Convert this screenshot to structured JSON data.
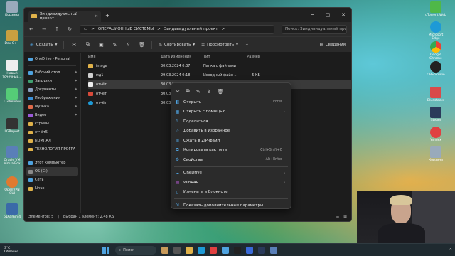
{
  "window": {
    "tab_title": "Зиндивидуальный проект",
    "tab_close": "×",
    "new_tab": "+",
    "controls": {
      "minimize": "─",
      "maximize": "□",
      "close": "✕"
    }
  },
  "nav": {
    "breadcrumb": [
      "ОПЕРАЦИОННЫЕ СИСТЕМЫ",
      "Зиндивидуальный проект"
    ],
    "breadcrumb_sep": ">",
    "search_placeholder": "Поиск: Зиндивидуальный про"
  },
  "toolbar": {
    "create": "Создать",
    "sort": "Сортировать",
    "view": "Просмотреть",
    "more": "···",
    "details": "Сведения"
  },
  "sidebar": {
    "items": [
      {
        "label": "OneDrive - Personal",
        "pinned": false
      },
      {
        "label": "Рабочий стол",
        "pinned": true
      },
      {
        "label": "Загрузки",
        "pinned": true
      },
      {
        "label": "Документы",
        "pinned": true
      },
      {
        "label": "Изображения",
        "pinned": true
      },
      {
        "label": "Музыка",
        "pinned": true
      },
      {
        "label": "Видео",
        "pinned": true
      },
      {
        "label": "стримы",
        "pinned": false
      },
      {
        "label": "отчёт5",
        "pinned": false
      },
      {
        "label": "КОМПАЛ",
        "pinned": false
      },
      {
        "label": "ТЕХНОЛОГИЯ ПРОГРА",
        "pinned": false
      }
    ],
    "bottom": [
      {
        "label": "Этот компьютер"
      },
      {
        "label": "OS (C:)"
      },
      {
        "label": "Сеть"
      },
      {
        "label": "Linux"
      }
    ]
  },
  "files": {
    "headers": {
      "name": "Имя",
      "date": "Дата изменения",
      "type": "Тип",
      "size": "Размер"
    },
    "rows": [
      {
        "name": "image",
        "date": "30.03.2024 0:37",
        "type": "Папка с файлами",
        "size": ""
      },
      {
        "name": "мд1",
        "date": "29.03.2024 0:18",
        "type": "Исходный файл ...",
        "size": "5 КБ"
      },
      {
        "name": "отчёт",
        "date": "30.03.2024 ...",
        "type": "",
        "size": ""
      },
      {
        "name": "отчёт",
        "date": "30.03.2024 ...",
        "type": "",
        "size": ""
      },
      {
        "name": "отчёт",
        "date": "30.03.2024 ...",
        "type": "",
        "size": ""
      }
    ]
  },
  "status": {
    "items_count": "Элементов: 5",
    "selected": "Выбран 1 элемент: 2,48 КБ"
  },
  "context_menu": {
    "items": [
      {
        "label": "Открыть",
        "shortcut": "Enter",
        "submenu": false
      },
      {
        "label": "Открыть с помощью",
        "shortcut": "",
        "submenu": true
      },
      {
        "label": "Поделиться",
        "shortcut": "",
        "submenu": false
      },
      {
        "label": "Добавить в избранное",
        "shortcut": "",
        "submenu": false
      },
      {
        "label": "Сжать в ZIP-файл",
        "shortcut": "",
        "submenu": false
      },
      {
        "label": "Копировать как путь",
        "shortcut": "Ctrl+Shift+C",
        "submenu": false
      },
      {
        "label": "Свойства",
        "shortcut": "Alt+Enter",
        "submenu": false
      },
      {
        "label": "OneDrive",
        "shortcut": "",
        "submenu": true
      },
      {
        "label": "WinRAR",
        "shortcut": "",
        "submenu": true
      },
      {
        "label": "Изменить в Блокноте",
        "shortcut": "",
        "submenu": false
      },
      {
        "label": "Показать дополнительные параметры",
        "shortcut": "",
        "submenu": false
      }
    ]
  },
  "desktop_icons_left": [
    {
      "label": "Корзина"
    },
    {
      "label": "Dev-C++"
    },
    {
      "label": "Новый точечный..."
    },
    {
      "label": "LGPreview"
    },
    {
      "label": "LGReport"
    },
    {
      "label": "Oracle VM VirtualBox"
    },
    {
      "label": "OpenVPN GUI"
    },
    {
      "label": "pgAdmin 4"
    }
  ],
  "desktop_icons_right": [
    {
      "label": "uTorrent Web"
    },
    {
      "label": "Microsoft Edge"
    },
    {
      "label": "Google Chrome"
    },
    {
      "label": "OBS Studio"
    },
    {
      "label": "Bluestacks"
    },
    {
      "label": "Steam"
    },
    {
      "label": "Yandex"
    },
    {
      "label": "Корзина"
    }
  ],
  "taskbar": {
    "temp": "3°C",
    "weather": "Облачно",
    "search": "Поиск"
  }
}
